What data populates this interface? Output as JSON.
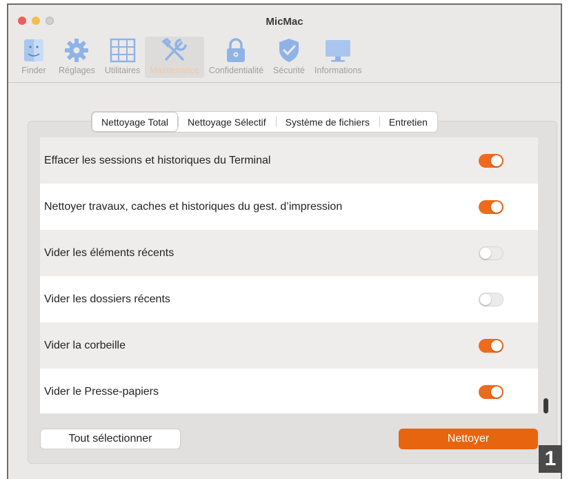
{
  "window": {
    "title": "MicMac"
  },
  "toolbar": {
    "items": [
      {
        "label": "Finder",
        "icon": "finder-icon"
      },
      {
        "label": "Réglages",
        "icon": "gear-icon"
      },
      {
        "label": "Utilitaires",
        "icon": "grid-icon"
      },
      {
        "label": "Maintenance",
        "icon": "tools-icon",
        "selected": true
      },
      {
        "label": "Confidentialité",
        "icon": "lock-icon"
      },
      {
        "label": "Sécurité",
        "icon": "shield-icon"
      },
      {
        "label": "Informations",
        "icon": "monitor-icon"
      }
    ]
  },
  "tabs": [
    {
      "label": "Nettoyage Total",
      "active": true
    },
    {
      "label": "Nettoyage Sélectif"
    },
    {
      "label": "Système de fichiers"
    },
    {
      "label": "Entretien"
    }
  ],
  "options": [
    {
      "label": "Effacer les sessions et historiques du Terminal",
      "enabled": true
    },
    {
      "label": "Nettoyer travaux, caches et historiques du gest. d’impression",
      "enabled": true
    },
    {
      "label": "Vider les éléments récents",
      "enabled": false
    },
    {
      "label": "Vider les dossiers récents",
      "enabled": false
    },
    {
      "label": "Vider la corbeille",
      "enabled": true
    },
    {
      "label": "Vider le Presse-papiers",
      "enabled": true
    }
  ],
  "actions": {
    "select_all": "Tout sélectionner",
    "clean": "Nettoyer"
  },
  "figure_badge": "1",
  "colors": {
    "accent": "#e8650f",
    "toggle_on": "#ee6a1c",
    "icon_blue": "#8fb3e6"
  }
}
